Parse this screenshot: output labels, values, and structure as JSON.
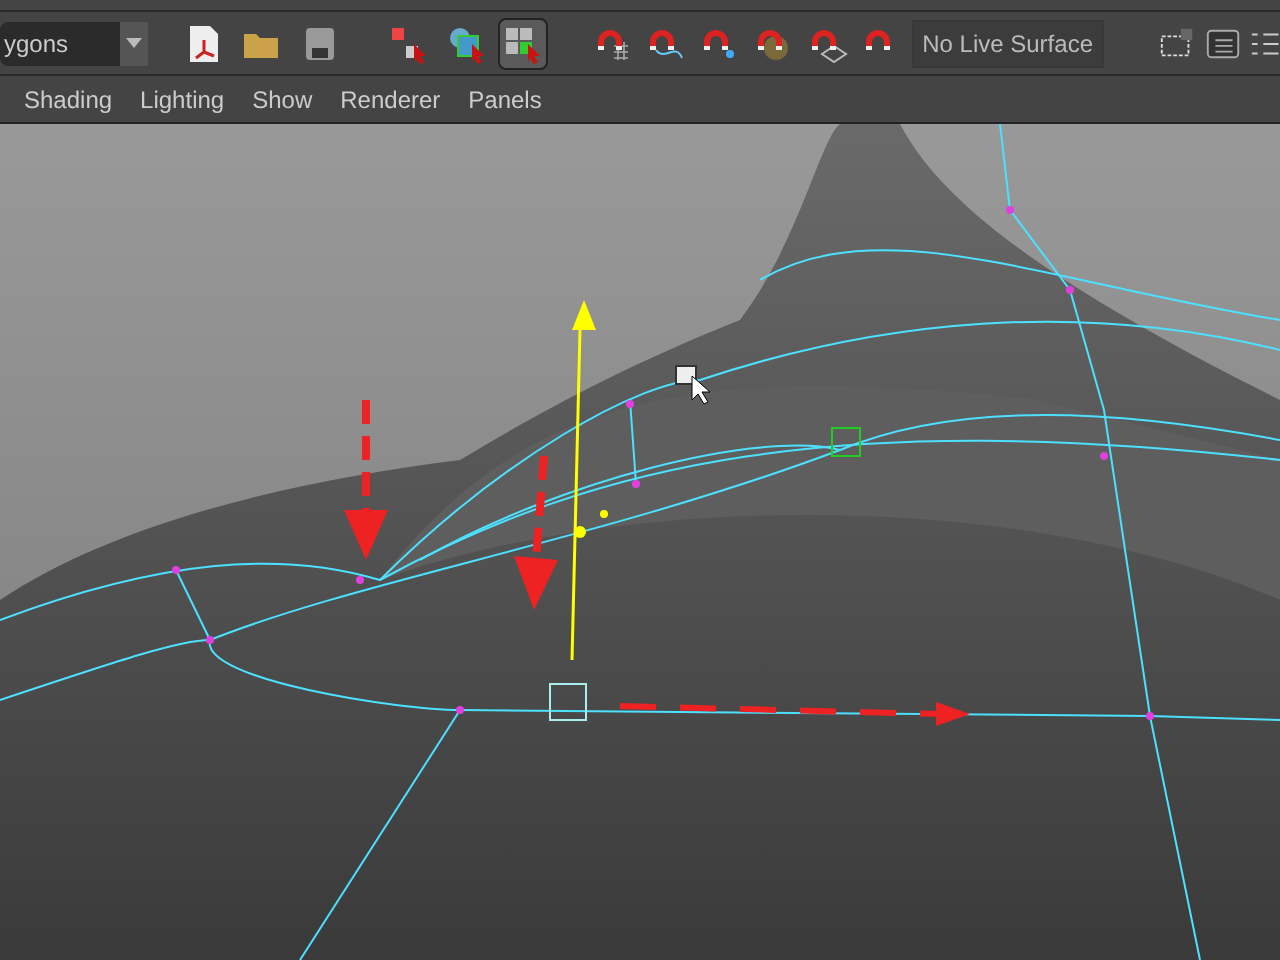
{
  "toolbar": {
    "mode_selector": "ygons",
    "tools": [
      {
        "selected": false
      },
      {
        "selected": false
      },
      {
        "selected": false
      },
      {
        "selected": false
      },
      {
        "selected": false
      },
      {
        "selected": true
      }
    ],
    "snap_tools": [
      {
        "selected": false
      },
      {
        "selected": false
      },
      {
        "selected": false
      },
      {
        "selected": false
      },
      {
        "selected": false
      },
      {
        "selected": false
      }
    ],
    "live_surface": "No Live Surface"
  },
  "panel_menu": [
    "Shading",
    "Lighting",
    "Show",
    "Renderer",
    "Panels"
  ]
}
